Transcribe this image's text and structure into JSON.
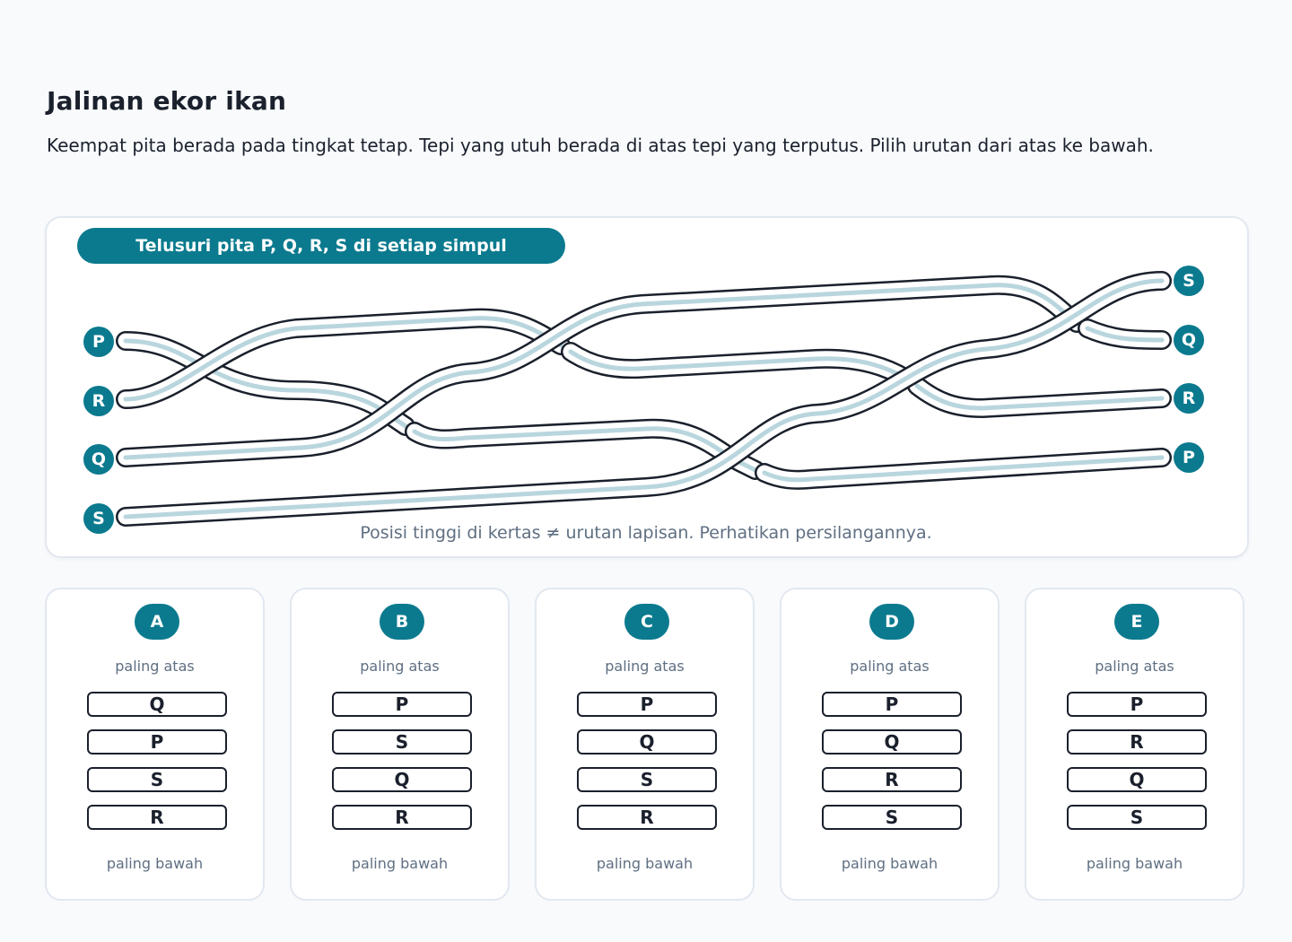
{
  "header": {
    "title": "Jalinan ekor ikan",
    "instructions": "Keempat pita berada pada tingkat tetap. Tepi yang utuh berada di atas tepi yang terputus. Pilih urutan dari atas ke bawah."
  },
  "diagram": {
    "banner": "Telusuri pita P, Q, R, S di setiap simpul",
    "caption": "Posisi tinggi di kertas ≠ urutan lapisan. Perhatikan persilangannya.",
    "left_labels": [
      "P",
      "R",
      "Q",
      "S"
    ],
    "right_labels": [
      "S",
      "Q",
      "R",
      "P"
    ],
    "ribbon_outline_color": "#1a202c",
    "ribbon_fill_color": "#ffffff",
    "ribbon_center_color": "#b9d6de",
    "accent_color": "#0b7a8e"
  },
  "options": [
    {
      "letter": "A",
      "top_label": "paling atas",
      "bottom_label": "paling bawah",
      "order": [
        "Q",
        "P",
        "S",
        "R"
      ]
    },
    {
      "letter": "B",
      "top_label": "paling atas",
      "bottom_label": "paling bawah",
      "order": [
        "P",
        "S",
        "Q",
        "R"
      ]
    },
    {
      "letter": "C",
      "top_label": "paling atas",
      "bottom_label": "paling bawah",
      "order": [
        "P",
        "Q",
        "S",
        "R"
      ]
    },
    {
      "letter": "D",
      "top_label": "paling atas",
      "bottom_label": "paling bawah",
      "order": [
        "P",
        "Q",
        "R",
        "S"
      ]
    },
    {
      "letter": "E",
      "top_label": "paling atas",
      "bottom_label": "paling bawah",
      "order": [
        "P",
        "R",
        "Q",
        "S"
      ]
    }
  ]
}
